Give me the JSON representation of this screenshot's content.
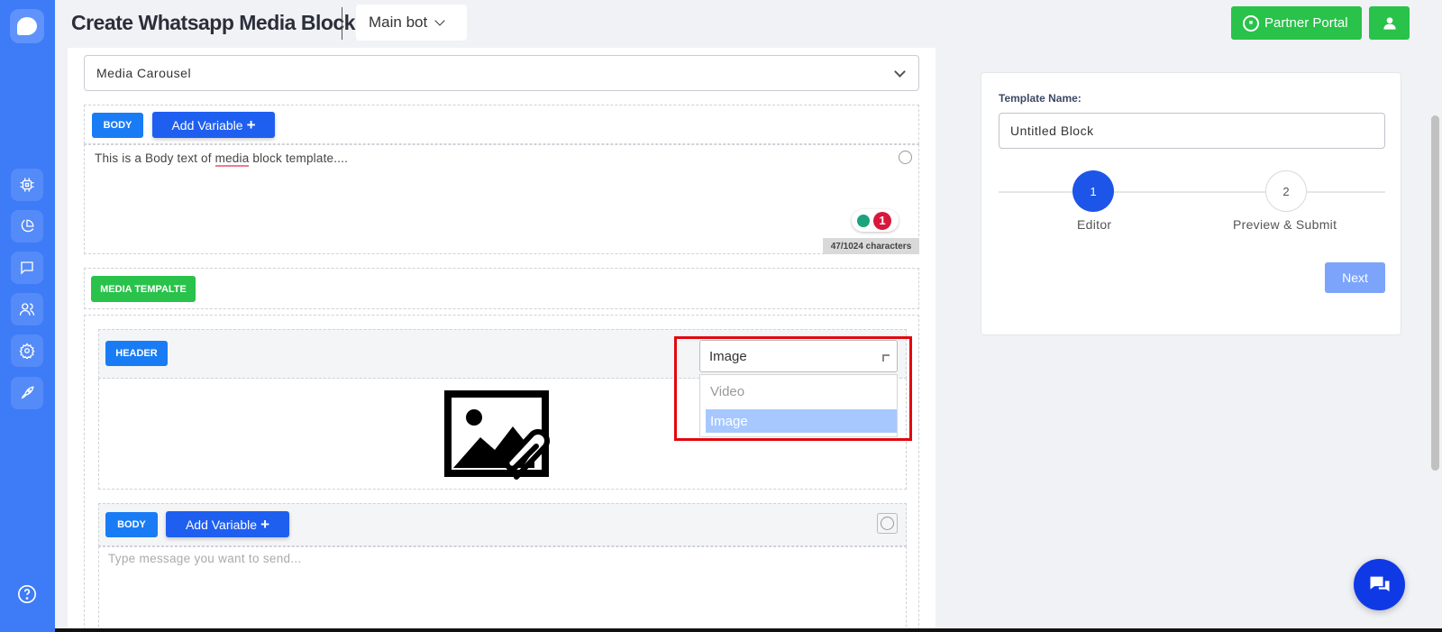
{
  "header": {
    "title": "Create Whatsapp Media Block",
    "bot_select": "Main bot",
    "partner_portal": "Partner Portal"
  },
  "sidebar": {
    "items": [
      {
        "icon": "cpu-icon"
      },
      {
        "icon": "pie-chart-icon"
      },
      {
        "icon": "chat-icon"
      },
      {
        "icon": "users-icon"
      },
      {
        "icon": "gear-icon"
      },
      {
        "icon": "rocket-icon"
      },
      {
        "icon": "help-icon"
      }
    ]
  },
  "editor": {
    "block_type": "Media Carousel",
    "body_tag": "BODY",
    "add_variable": "Add Variable",
    "body_text_pre": "This is a Body text of ",
    "body_text_word": "media",
    "body_text_post": " block template....",
    "grammar_count": "1",
    "char_count": "47/1024 characters",
    "media_template_tag": "MEDIA TEMPALTE",
    "header_tag": "HEADER",
    "header_type_selected": "Image",
    "header_type_options": [
      "Video",
      "Image"
    ],
    "card_body_tag": "BODY",
    "card_add_variable": "Add Variable",
    "card_body_placeholder": "Type message you want to send..."
  },
  "template_panel": {
    "name_label": "Template Name:",
    "name_value": "Untitled Block",
    "steps": [
      {
        "number": "1",
        "label": "Editor"
      },
      {
        "number": "2",
        "label": "Preview & Submit"
      }
    ],
    "next_button": "Next"
  },
  "colors": {
    "sidebar": "#3e7bf7",
    "primary": "#1f5ff0",
    "green": "#29c24a",
    "highlight_frame": "#e3070f"
  }
}
